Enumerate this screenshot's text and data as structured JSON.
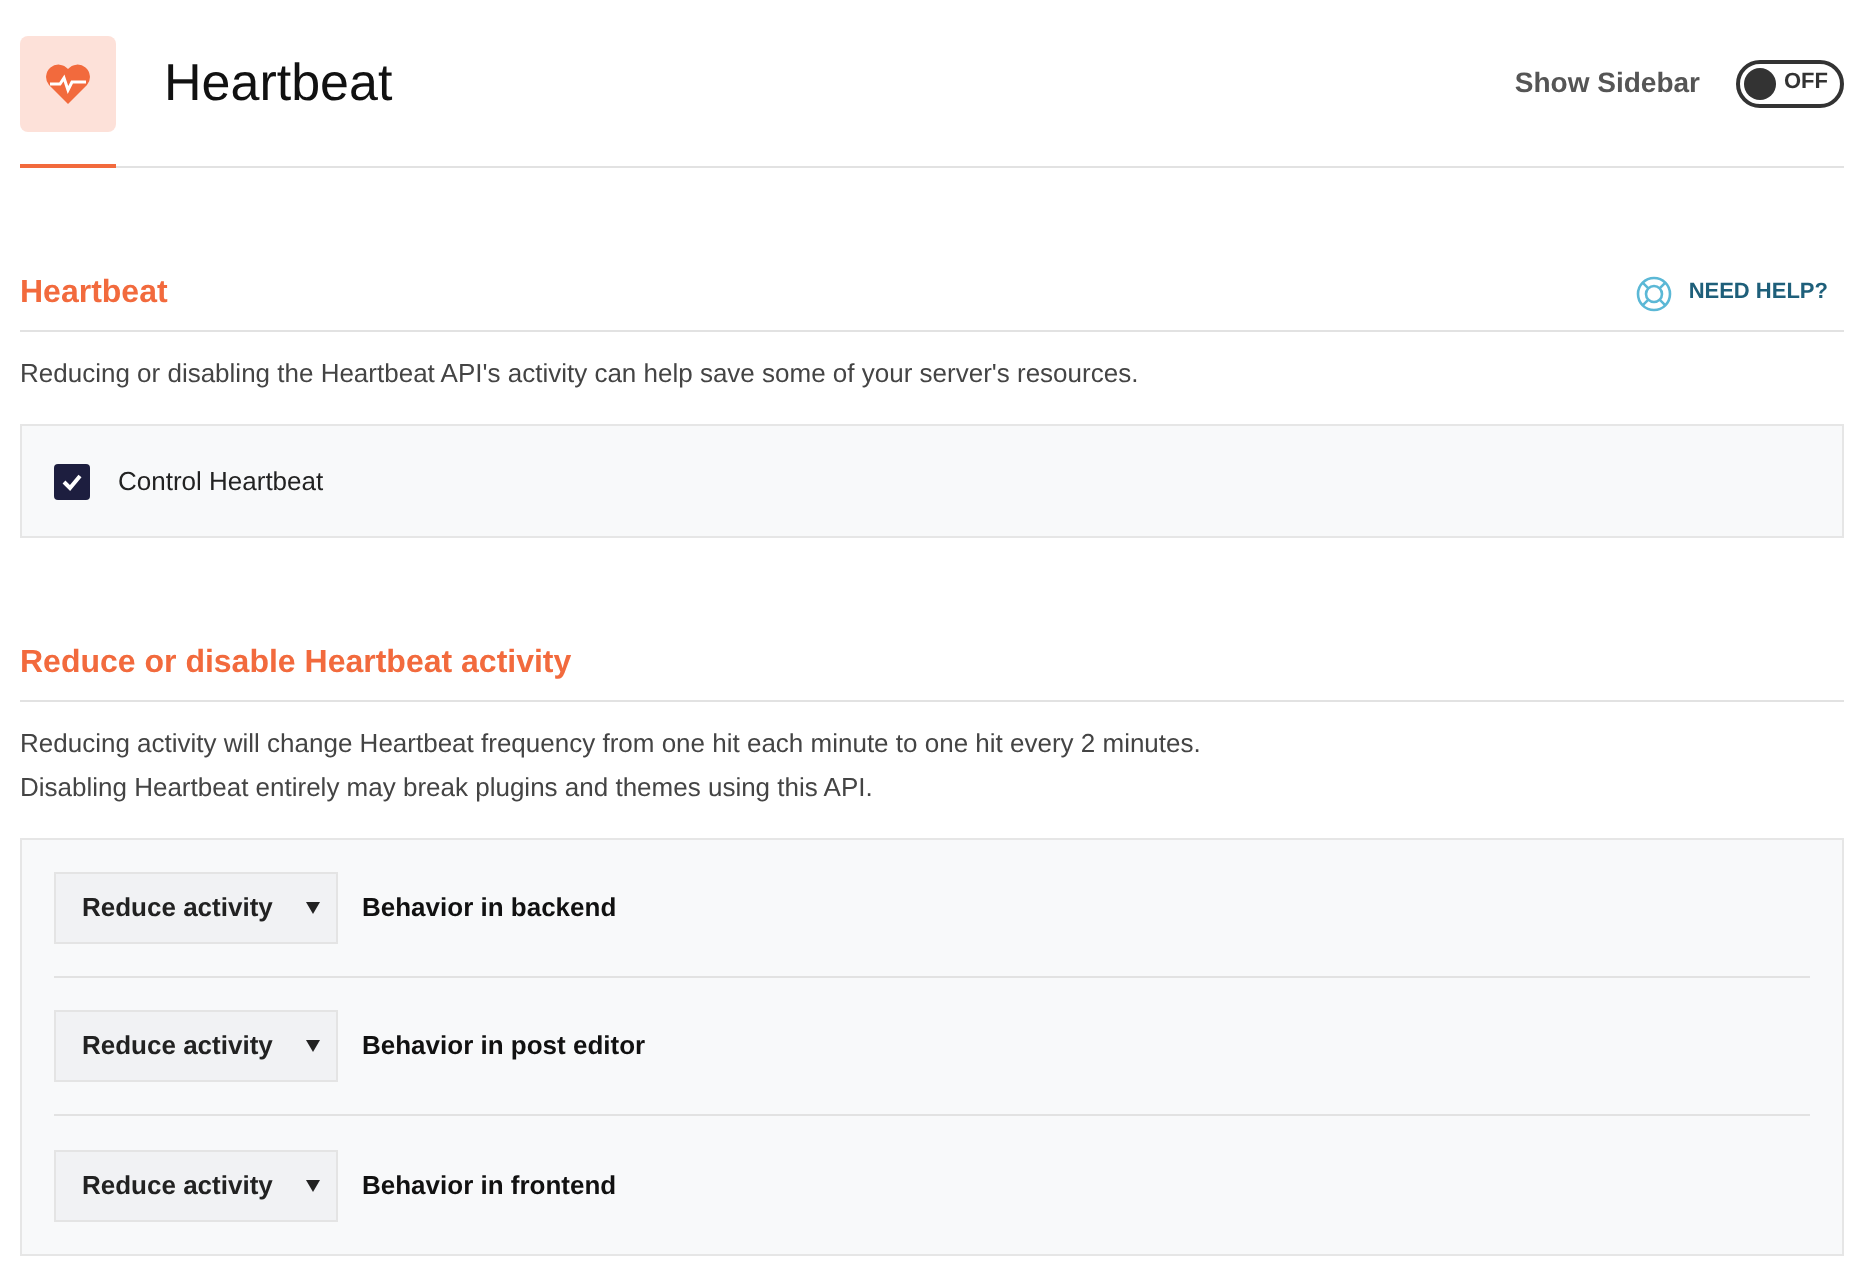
{
  "header": {
    "title": "Heartbeat",
    "sidebar_toggle": {
      "label": "Show Sidebar",
      "on": false,
      "state_text": "OFF"
    }
  },
  "sections": [
    {
      "heading": "Heartbeat",
      "help_link": "NEED HELP?",
      "description": [
        "Reducing or disabling the Heartbeat API's activity can help save some of your server's resources."
      ],
      "options": [
        {
          "kind": "checkbox",
          "label": "Control Heartbeat",
          "checked": true
        }
      ]
    },
    {
      "heading": "Reduce or disable Heartbeat activity",
      "description": [
        "Reducing activity will change Heartbeat frequency from one hit each minute to one hit every 2 minutes.",
        "Disabling Heartbeat entirely may break plugins and themes using this API."
      ],
      "options": [
        {
          "kind": "select",
          "value": "Reduce activity",
          "label": "Behavior in backend"
        },
        {
          "kind": "select",
          "value": "Reduce activity",
          "label": "Behavior in post editor"
        },
        {
          "kind": "select",
          "value": "Reduce activity",
          "label": "Behavior in frontend"
        }
      ]
    }
  ]
}
